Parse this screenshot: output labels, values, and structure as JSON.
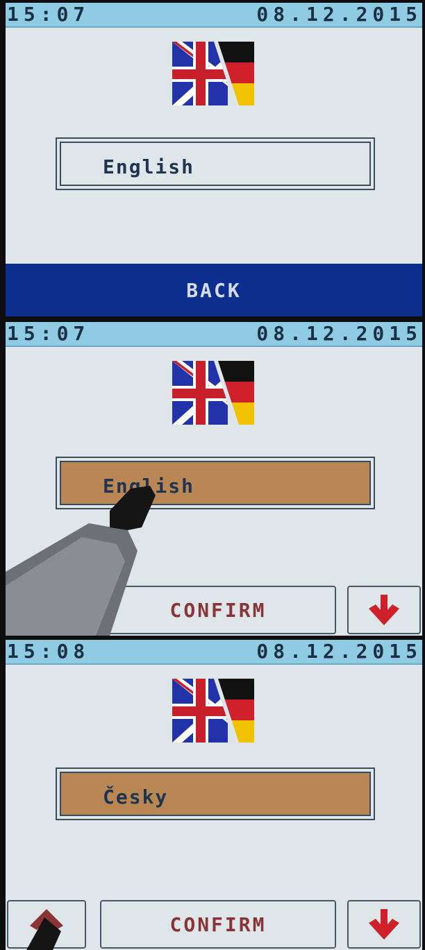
{
  "screens": [
    {
      "status": {
        "time": "15:07",
        "date": "08.12.2015"
      },
      "language": "English",
      "back_label": "BACK",
      "selected": false
    },
    {
      "status": {
        "time": "15:07",
        "date": "08.12.2015"
      },
      "language": "English",
      "confirm_label": "CONFIRM",
      "selected": true
    },
    {
      "status": {
        "time": "15:08",
        "date": "08.12.2015"
      },
      "language": "Česky",
      "confirm_label": "CONFIRM",
      "selected": true
    }
  ],
  "icons": {
    "language_flag": "uk-germany-flag-icon",
    "down": "arrow-down-icon",
    "up": "arrow-up-icon"
  },
  "colors": {
    "status_bar": "#8fcce4",
    "screen_bg": "#dfe6ea",
    "selected_bg": "#b98754",
    "back_bar": "#0c2f8e",
    "button_text": "#8b3438",
    "arrow": "#d0202a"
  }
}
